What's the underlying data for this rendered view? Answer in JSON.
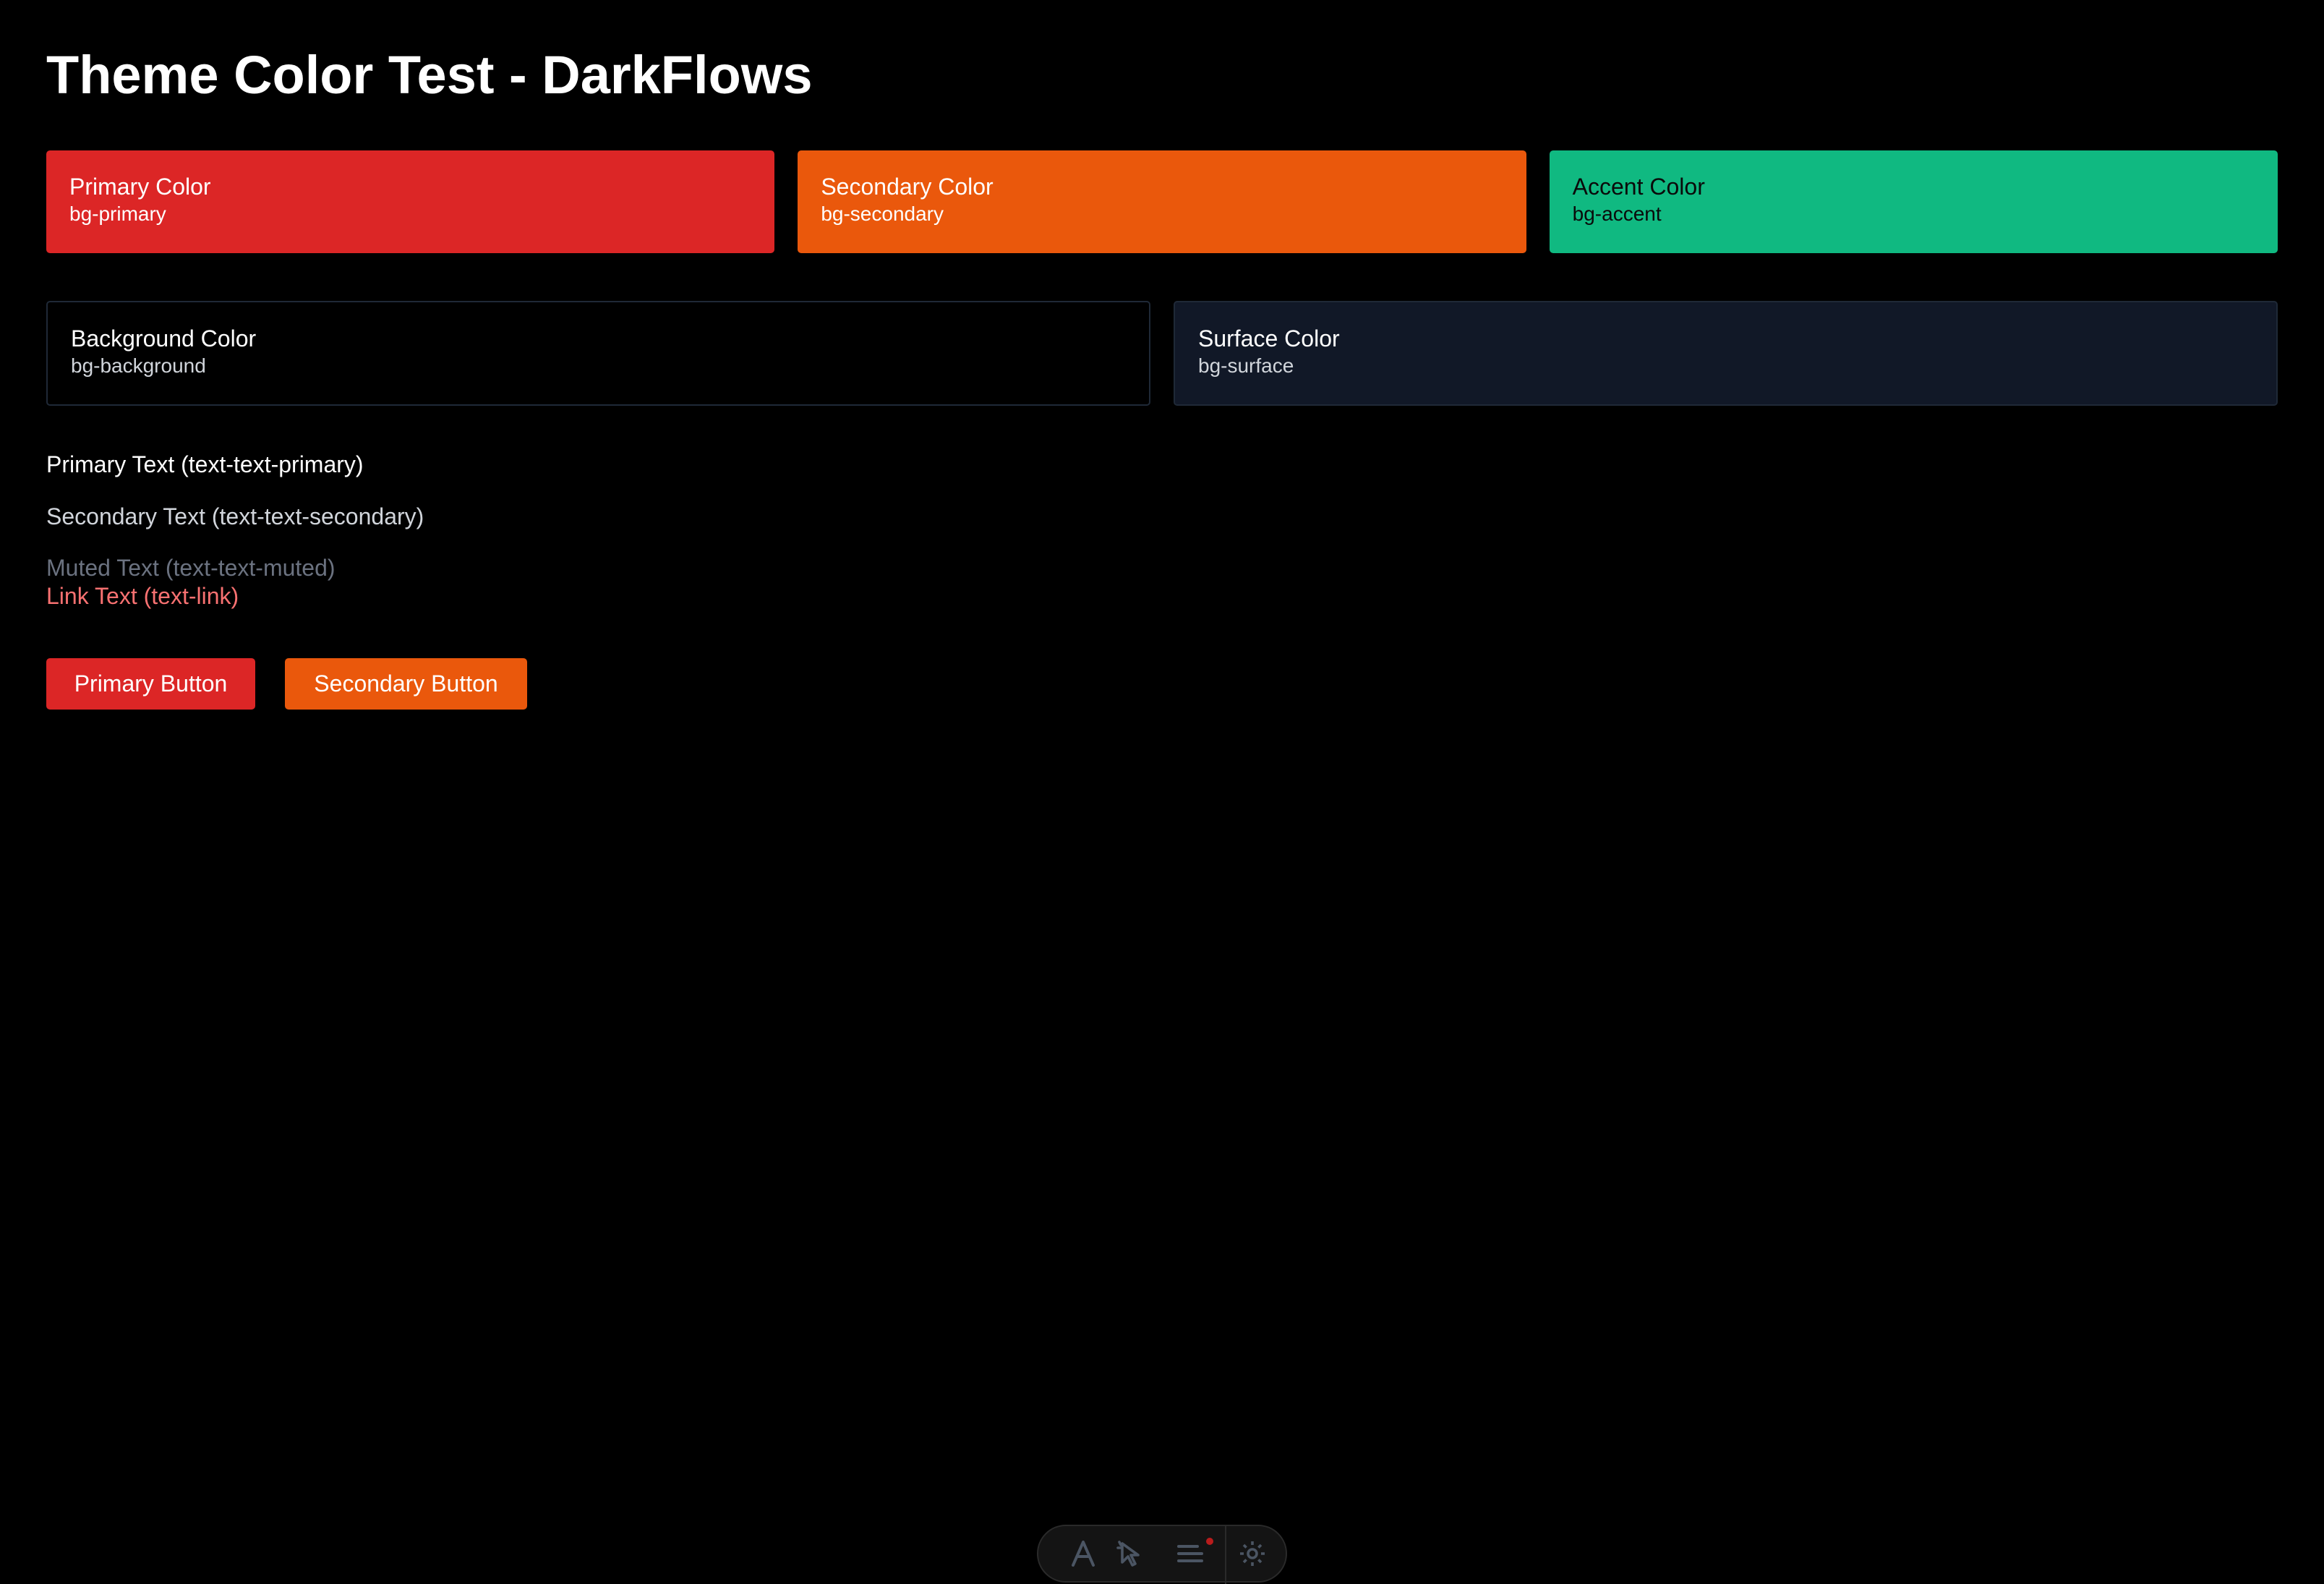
{
  "page": {
    "title": "Theme Color Test - DarkFlows"
  },
  "swatches": {
    "primary": {
      "name": "Primary Color",
      "class": "bg-primary",
      "color": "#dc2626"
    },
    "secondary": {
      "name": "Secondary Color",
      "class": "bg-secondary",
      "color": "#ea580c"
    },
    "accent": {
      "name": "Accent Color",
      "class": "bg-accent",
      "color": "#10b981"
    },
    "background": {
      "name": "Background Color",
      "class": "bg-background",
      "color": "#000000"
    },
    "surface": {
      "name": "Surface Color",
      "class": "bg-surface",
      "color": "#111827"
    }
  },
  "texts": {
    "primary": "Primary Text (text-text-primary)",
    "secondary": "Secondary Text (text-text-secondary)",
    "muted": "Muted Text (text-text-muted)",
    "link": "Link Text (text-link)"
  },
  "text_colors": {
    "primary": "#ffffff",
    "secondary": "#d1d5db",
    "muted": "#6b7280",
    "link": "#f87171"
  },
  "buttons": {
    "primary": "Primary Button",
    "secondary": "Secondary Button"
  },
  "dock": {
    "icons": [
      "text-icon",
      "pointer-icon",
      "menu-icon",
      "gear-icon"
    ],
    "notification_color": "#b91c1c"
  }
}
